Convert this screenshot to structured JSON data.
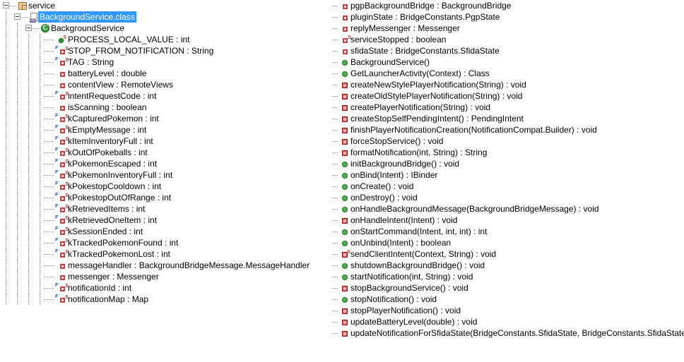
{
  "view": {
    "name": "Outline",
    "theme": {
      "background": "#ffffff",
      "text": "#000000",
      "selection_bg": "#3399ff",
      "selection_fg": "#ffffff",
      "tree_line": "#8a8a8a",
      "package_icon": "#e8c89a",
      "class_icon": "#3a9e3a",
      "public_member": "#4caf50",
      "private_member": "#e04848",
      "static_marker": "#c0392b",
      "final_marker": "#2a5caa"
    }
  },
  "tree": {
    "package": {
      "label": "service",
      "icon": "package-icon",
      "expanded": true
    },
    "class_file": {
      "label": "BackgroundService.class",
      "icon": "class-file-icon",
      "expanded": true,
      "selected": true
    },
    "class": {
      "label": "BackgroundService",
      "icon": "java-class-icon",
      "expanded": true
    }
  },
  "members_left": [
    {
      "label": "PROCESS_LOCAL_VALUE : int",
      "icon": "public-static-field-icon",
      "kind": "field",
      "visibility": "public",
      "static": true,
      "final": false
    },
    {
      "label": "STOP_FROM_NOTIFICATION : String",
      "icon": "private-static-final-field-icon",
      "kind": "field",
      "visibility": "private",
      "static": true,
      "final": true
    },
    {
      "label": "TAG : String",
      "icon": "private-static-final-field-icon",
      "kind": "field",
      "visibility": "private",
      "static": true,
      "final": true
    },
    {
      "label": "batteryLevel : double",
      "icon": "private-field-icon",
      "kind": "field",
      "visibility": "private",
      "static": false,
      "final": false
    },
    {
      "label": "contentView : RemoteViews",
      "icon": "private-field-icon",
      "kind": "field",
      "visibility": "private",
      "static": false,
      "final": false
    },
    {
      "label": "intentRequestCode : int",
      "icon": "private-static-final-field-icon",
      "kind": "field",
      "visibility": "private",
      "static": true,
      "final": true
    },
    {
      "label": "isScanning : boolean",
      "icon": "private-field-icon",
      "kind": "field",
      "visibility": "private",
      "static": false,
      "final": false
    },
    {
      "label": "kCapturedPokemon : int",
      "icon": "private-static-final-field-icon",
      "kind": "field",
      "visibility": "private",
      "static": true,
      "final": true
    },
    {
      "label": "kEmptyMessage : int",
      "icon": "private-static-final-field-icon",
      "kind": "field",
      "visibility": "private",
      "static": true,
      "final": true
    },
    {
      "label": "kItemInventoryFull : int",
      "icon": "private-static-final-field-icon",
      "kind": "field",
      "visibility": "private",
      "static": true,
      "final": true
    },
    {
      "label": "kOutOfPokeballs : int",
      "icon": "private-static-final-field-icon",
      "kind": "field",
      "visibility": "private",
      "static": true,
      "final": true
    },
    {
      "label": "kPokemonEscaped : int",
      "icon": "private-static-final-field-icon",
      "kind": "field",
      "visibility": "private",
      "static": true,
      "final": true
    },
    {
      "label": "kPokemonInventoryFull : int",
      "icon": "private-static-final-field-icon",
      "kind": "field",
      "visibility": "private",
      "static": true,
      "final": true
    },
    {
      "label": "kPokestopCooldown : int",
      "icon": "private-static-final-field-icon",
      "kind": "field",
      "visibility": "private",
      "static": true,
      "final": true
    },
    {
      "label": "kPokestopOutOfRange : int",
      "icon": "private-static-final-field-icon",
      "kind": "field",
      "visibility": "private",
      "static": true,
      "final": true
    },
    {
      "label": "kRetrievedItems : int",
      "icon": "private-static-final-field-icon",
      "kind": "field",
      "visibility": "private",
      "static": true,
      "final": true
    },
    {
      "label": "kRetrievedOneItem : int",
      "icon": "private-static-final-field-icon",
      "kind": "field",
      "visibility": "private",
      "static": true,
      "final": true
    },
    {
      "label": "kSessionEnded : int",
      "icon": "private-static-final-field-icon",
      "kind": "field",
      "visibility": "private",
      "static": true,
      "final": true
    },
    {
      "label": "kTrackedPokemonFound : int",
      "icon": "private-static-final-field-icon",
      "kind": "field",
      "visibility": "private",
      "static": true,
      "final": true
    },
    {
      "label": "kTrackedPokemonLost : int",
      "icon": "private-static-final-field-icon",
      "kind": "field",
      "visibility": "private",
      "static": true,
      "final": true
    },
    {
      "label": "messageHandler : BackgroundBridgeMessage.MessageHandler",
      "icon": "private-field-icon",
      "kind": "field",
      "visibility": "private",
      "static": false,
      "final": false
    },
    {
      "label": "messenger : Messenger",
      "icon": "private-field-icon",
      "kind": "field",
      "visibility": "private",
      "static": false,
      "final": false
    },
    {
      "label": "notificationId : int",
      "icon": "private-static-final-field-icon",
      "kind": "field",
      "visibility": "private",
      "static": true,
      "final": true
    },
    {
      "label": "notificationMap : Map",
      "icon": "private-static-final-field-icon",
      "kind": "field",
      "visibility": "private",
      "static": true,
      "final": true
    }
  ],
  "members_right": [
    {
      "label": "pgpBackgroundBridge : BackgroundBridge",
      "icon": "private-field-icon",
      "kind": "field",
      "visibility": "private",
      "static": false,
      "final": false
    },
    {
      "label": "pluginState : BridgeConstants.PgpState",
      "icon": "private-field-icon",
      "kind": "field",
      "visibility": "private",
      "static": false,
      "final": false
    },
    {
      "label": "replyMessenger : Messenger",
      "icon": "private-field-icon",
      "kind": "field",
      "visibility": "private",
      "static": false,
      "final": false
    },
    {
      "label": "serviceStopped : boolean",
      "icon": "private-static-field-icon",
      "kind": "field",
      "visibility": "private",
      "static": true,
      "final": false
    },
    {
      "label": "sfidaState : BridgeConstants.SfidaState",
      "icon": "private-field-icon",
      "kind": "field",
      "visibility": "private",
      "static": false,
      "final": false
    },
    {
      "label": "BackgroundService()",
      "icon": "public-method-icon",
      "kind": "constructor",
      "visibility": "public",
      "static": false,
      "final": false
    },
    {
      "label": "GetLauncherActivity(Context) : Class",
      "icon": "public-method-icon",
      "kind": "method",
      "visibility": "public",
      "static": false,
      "final": false
    },
    {
      "label": "createNewStylePlayerNotification(String) : void",
      "icon": "private-method-icon",
      "kind": "method",
      "visibility": "private",
      "static": false,
      "final": false
    },
    {
      "label": "createOldStylePlayerNotification(String) : void",
      "icon": "private-method-icon",
      "kind": "method",
      "visibility": "private",
      "static": false,
      "final": false
    },
    {
      "label": "createPlayerNotification(String) : void",
      "icon": "private-method-icon",
      "kind": "method",
      "visibility": "private",
      "static": false,
      "final": false
    },
    {
      "label": "createStopSelfPendingIntent() : PendingIntent",
      "icon": "private-method-icon",
      "kind": "method",
      "visibility": "private",
      "static": false,
      "final": false
    },
    {
      "label": "finishPlayerNotificationCreation(NotificationCompat.Builder) : void",
      "icon": "private-method-icon",
      "kind": "method",
      "visibility": "private",
      "static": false,
      "final": false
    },
    {
      "label": "forceStopService() : void",
      "icon": "private-method-icon",
      "kind": "method",
      "visibility": "private",
      "static": false,
      "final": false
    },
    {
      "label": "formatNotification(int, String) : String",
      "icon": "private-method-icon",
      "kind": "method",
      "visibility": "private",
      "static": false,
      "final": false
    },
    {
      "label": "initBackgroundBridge() : void",
      "icon": "public-method-icon",
      "kind": "method",
      "visibility": "public",
      "static": false,
      "final": false
    },
    {
      "label": "onBind(Intent) : IBinder",
      "icon": "public-method-icon",
      "kind": "method",
      "visibility": "public",
      "static": false,
      "final": false
    },
    {
      "label": "onCreate() : void",
      "icon": "public-method-icon",
      "kind": "method",
      "visibility": "public",
      "static": false,
      "final": false
    },
    {
      "label": "onDestroy() : void",
      "icon": "public-method-icon",
      "kind": "method",
      "visibility": "public",
      "static": false,
      "final": false
    },
    {
      "label": "onHandleBackgroundMessage(BackgroundBridgeMessage) : void",
      "icon": "public-method-icon",
      "kind": "method",
      "visibility": "public",
      "static": false,
      "final": false
    },
    {
      "label": "onHandleIntent(Intent) : void",
      "icon": "private-method-icon",
      "kind": "method",
      "visibility": "private",
      "static": false,
      "final": false
    },
    {
      "label": "onStartCommand(Intent, int, int) : int",
      "icon": "public-method-icon",
      "kind": "method",
      "visibility": "public",
      "static": false,
      "final": false
    },
    {
      "label": "onUnbind(Intent) : boolean",
      "icon": "public-method-icon",
      "kind": "method",
      "visibility": "public",
      "static": false,
      "final": false
    },
    {
      "label": "sendClientIntent(Context, String) : void",
      "icon": "private-static-method-icon",
      "kind": "method",
      "visibility": "private",
      "static": true,
      "final": false
    },
    {
      "label": "shutdownBackgroundBridge() : void",
      "icon": "public-method-icon",
      "kind": "method",
      "visibility": "public",
      "static": false,
      "final": false
    },
    {
      "label": "startNotification(int, String) : void",
      "icon": "public-method-icon",
      "kind": "method",
      "visibility": "public",
      "static": false,
      "final": false
    },
    {
      "label": "stopBackgroundService() : void",
      "icon": "private-method-icon",
      "kind": "method",
      "visibility": "private",
      "static": false,
      "final": false
    },
    {
      "label": "stopNotification() : void",
      "icon": "public-method-icon",
      "kind": "method",
      "visibility": "public",
      "static": false,
      "final": false
    },
    {
      "label": "stopPlayerNotification() : void",
      "icon": "private-method-icon",
      "kind": "method",
      "visibility": "private",
      "static": false,
      "final": false
    },
    {
      "label": "updateBatteryLevel(double) : void",
      "icon": "private-method-icon",
      "kind": "method",
      "visibility": "private",
      "static": false,
      "final": false
    },
    {
      "label": "updateNotificationForSfidaState(BridgeConstants.SfidaState, BridgeConstants.SfidaState) : void",
      "icon": "private-method-icon",
      "kind": "method",
      "visibility": "private",
      "static": false,
      "final": false
    }
  ]
}
